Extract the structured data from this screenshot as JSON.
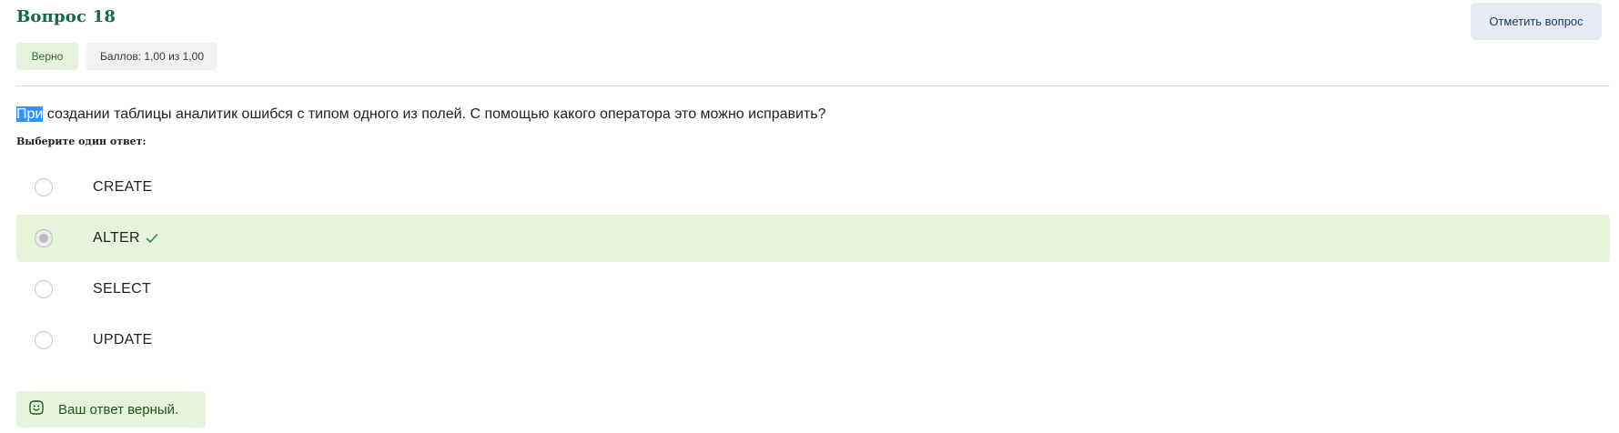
{
  "question": {
    "title": "Вопрос 18",
    "flag_button": "Отметить вопрос",
    "status_badge": "Верно",
    "score_badge": "Баллов: 1,00 из 1,00",
    "text_highlighted": "При",
    "text_rest": " создании таблицы аналитик ошибся с типом одного из полей. С помощью какого оператора это можно исправить?",
    "prompt": "Выберите один ответ:"
  },
  "options": [
    {
      "label": "CREATE",
      "selected": false,
      "correct": false
    },
    {
      "label": "ALTER",
      "selected": true,
      "correct": true
    },
    {
      "label": "SELECT",
      "selected": false,
      "correct": false
    },
    {
      "label": "UPDATE",
      "selected": false,
      "correct": false
    }
  ],
  "feedback": {
    "text": "Ваш ответ верный.",
    "icon": "smile-icon"
  },
  "colors": {
    "title_green": "#0f6a4e",
    "correct_bg": "#e8f3dc",
    "flag_bg": "#e6eaf2",
    "check_green": "#2e8a3c"
  }
}
